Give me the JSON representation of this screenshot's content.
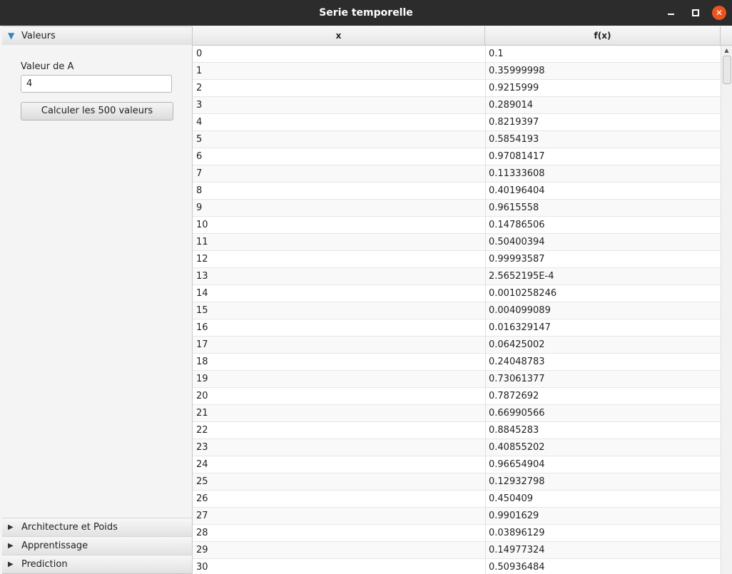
{
  "window": {
    "title": "Serie temporelle"
  },
  "left_panel": {
    "sections": [
      {
        "label": "Valeurs",
        "expanded": true
      },
      {
        "label": "Architecture et Poids",
        "expanded": false
      },
      {
        "label": "Apprentissage",
        "expanded": false
      },
      {
        "label": "Prediction",
        "expanded": false
      }
    ],
    "valeurs": {
      "field_label": "Valeur de A",
      "field_value": "4",
      "button_label": "Calculer les 500 valeurs"
    }
  },
  "table": {
    "columns": [
      "x",
      "f(x)"
    ],
    "rows": [
      [
        "0",
        "0.1"
      ],
      [
        "1",
        "0.35999998"
      ],
      [
        "2",
        "0.9215999"
      ],
      [
        "3",
        "0.289014"
      ],
      [
        "4",
        "0.8219397"
      ],
      [
        "5",
        "0.5854193"
      ],
      [
        "6",
        "0.97081417"
      ],
      [
        "7",
        "0.11333608"
      ],
      [
        "8",
        "0.40196404"
      ],
      [
        "9",
        "0.9615558"
      ],
      [
        "10",
        "0.14786506"
      ],
      [
        "11",
        "0.50400394"
      ],
      [
        "12",
        "0.99993587"
      ],
      [
        "13",
        "2.5652195E-4"
      ],
      [
        "14",
        "0.0010258246"
      ],
      [
        "15",
        "0.004099089"
      ],
      [
        "16",
        "0.016329147"
      ],
      [
        "17",
        "0.06425002"
      ],
      [
        "18",
        "0.24048783"
      ],
      [
        "19",
        "0.73061377"
      ],
      [
        "20",
        "0.7872692"
      ],
      [
        "21",
        "0.66990566"
      ],
      [
        "22",
        "0.8845283"
      ],
      [
        "23",
        "0.40855202"
      ],
      [
        "24",
        "0.96654904"
      ],
      [
        "25",
        "0.12932798"
      ],
      [
        "26",
        "0.450409"
      ],
      [
        "27",
        "0.9901629"
      ],
      [
        "28",
        "0.03896129"
      ],
      [
        "29",
        "0.14977324"
      ],
      [
        "30",
        "0.50936484"
      ]
    ]
  }
}
